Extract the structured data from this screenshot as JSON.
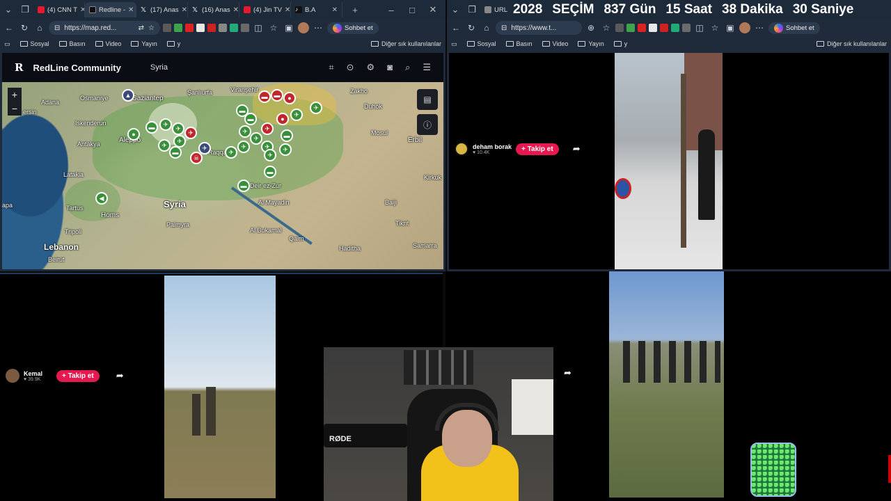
{
  "left_browser": {
    "tabs": [
      {
        "label": "(4) CNN T",
        "color": "#e8192c"
      },
      {
        "label": "Redline -",
        "color": "#111111"
      },
      {
        "label": "(17) Anas",
        "color": "#000000"
      },
      {
        "label": "(16) Anas",
        "color": "#000000"
      },
      {
        "label": "(4) Jin TV",
        "color": "#e8192c"
      },
      {
        "label": "B.A",
        "color": "#111111"
      }
    ],
    "url": "https://map.red...",
    "chat_label": "Sohbet et",
    "bookmarks": [
      "Sosyal",
      "Basın",
      "Video",
      "Yayın",
      "y"
    ],
    "other_bookmarks": "Diğer sık kullanılanlar"
  },
  "redline": {
    "logo": "R",
    "title": "RedLine Community",
    "country": "Syria",
    "zoom_in": "+",
    "zoom_out": "−",
    "place_labels": [
      "Adana",
      "Osmaniye",
      "Gaziantep",
      "Şanlıurfa",
      "Viranşehir",
      "Zakho",
      "Duhok",
      "Mosul",
      "Erbil",
      "Iskenderun",
      "Antakya",
      "Aleppo",
      "Raqqah",
      "Latakia",
      "Tartus",
      "Homs",
      "Syria",
      "Palmyra",
      "Tripoli",
      "Lebanon",
      "Beirut",
      "Al Mayadin",
      "Al Bukamal",
      "Qaim",
      "Haditha",
      "Baiji",
      "Tikrit",
      "Kirkuk",
      "Samarra",
      "Deir ez-Zur",
      "ersin",
      "apa"
    ]
  },
  "timer": {
    "year": "2028",
    "word": "SEÇİM",
    "days": "837 Gün",
    "hours": "15 Saat",
    "minutes": "38 Dakika",
    "seconds": "30 Saniye"
  },
  "right_browser": {
    "tab": "URL",
    "url": "https://www.t...",
    "chat_label": "Sohbet et",
    "bookmarks": [
      "Sosyal",
      "Basın",
      "Video",
      "Yayın",
      "y"
    ],
    "other_bookmarks": "Diğer sık kullanılanlar"
  },
  "video1": {
    "user": "deham borak",
    "count": "♥ 10.4K",
    "follow": "+ Takip et"
  },
  "video2": {
    "user": "Kemal",
    "count": "♥ 39.9K",
    "follow": "+ Takip et"
  },
  "webcam": {
    "mic_brand": "RØDE"
  }
}
